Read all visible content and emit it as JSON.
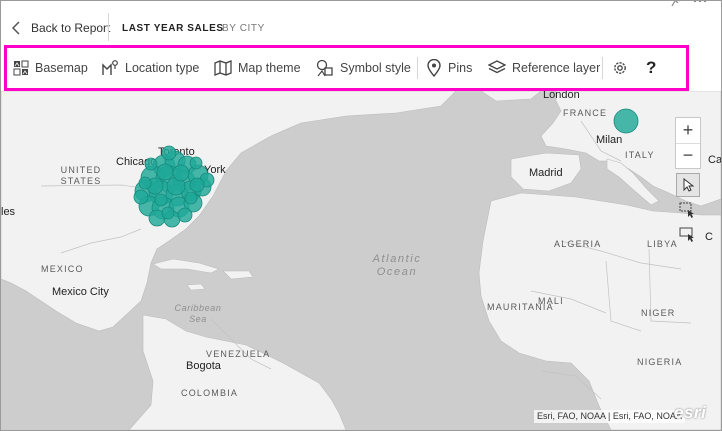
{
  "header": {
    "back_label": "Back to Report",
    "tabs": [
      {
        "label": "LAST YEAR SALES",
        "active": true
      },
      {
        "label": "BY CITY",
        "active": false
      }
    ],
    "top_icons": [
      "pin-icon",
      "more-icon"
    ]
  },
  "toolbar": {
    "highlight_color": "#ff00c8",
    "items": [
      {
        "label": "Basemap",
        "icon": "basemap-icon"
      },
      {
        "label": "Location type",
        "icon": "location-type-icon"
      },
      {
        "label": "Map theme",
        "icon": "map-theme-icon"
      },
      {
        "label": "Symbol style",
        "icon": "symbol-style-icon"
      },
      {
        "label": "Pins",
        "icon": "pin-icon"
      },
      {
        "label": "Reference layer",
        "icon": "layers-icon"
      }
    ],
    "settings_icon": "gear-icon",
    "help_label": "?"
  },
  "map": {
    "bubble_color": "#20a898",
    "land_color": "#f2f2f2",
    "water_color": "#cdcdcd",
    "cities": [
      "London",
      "Milan",
      "Chicago",
      "Toronto",
      "York",
      "Madrid",
      "Mexico City",
      "Bogota",
      "les"
    ],
    "countries": [
      "FRANCE",
      "ITALY",
      "UNITED STATES",
      "MEXICO",
      "VENEZUELA",
      "COLOMBIA",
      "ALGERIA",
      "LIBYA",
      "MALI",
      "NIGER",
      "NIGERIA",
      "MAURITANIA"
    ],
    "oceans": [
      "Atlantic Ocean",
      "Caribbean Sea"
    ],
    "edge_labels": [
      "C",
      "Cairo"
    ],
    "zoom_in": "+",
    "zoom_out": "−",
    "attribution": "Esri, FAO, NOAA | Esri, FAO, NOAA",
    "logo": "esri"
  }
}
